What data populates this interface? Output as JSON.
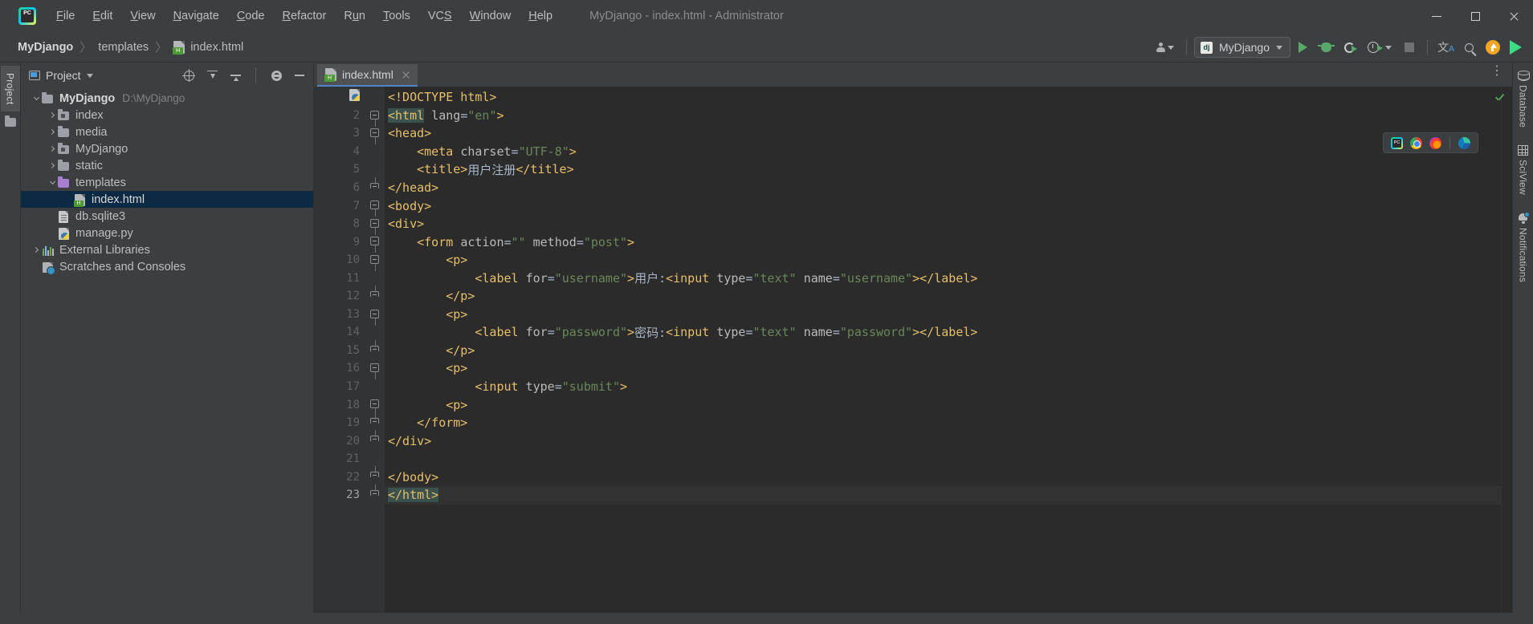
{
  "window": {
    "title": "MyDjango - index.html - Administrator",
    "app_icon": "pycharm-logo-icon",
    "minimize_label": "Minimize",
    "maximize_label": "Maximize",
    "close_label": "Close"
  },
  "menu": [
    {
      "label": "File",
      "mnemonic": "F"
    },
    {
      "label": "Edit",
      "mnemonic": "E"
    },
    {
      "label": "View",
      "mnemonic": "V"
    },
    {
      "label": "Navigate",
      "mnemonic": "N"
    },
    {
      "label": "Code",
      "mnemonic": "C"
    },
    {
      "label": "Refactor",
      "mnemonic": "R"
    },
    {
      "label": "Run",
      "mnemonic": "u"
    },
    {
      "label": "Tools",
      "mnemonic": "T"
    },
    {
      "label": "VCS",
      "mnemonic": "S"
    },
    {
      "label": "Window",
      "mnemonic": "W"
    },
    {
      "label": "Help",
      "mnemonic": "H"
    }
  ],
  "breadcrumb": {
    "items": [
      "MyDjango",
      "templates",
      "index.html"
    ],
    "separator": "〉",
    "file_icon": "html-file-icon"
  },
  "toolbar": {
    "user_icon": "user-account-icon",
    "run_config": {
      "icon": "django-icon",
      "icon_text": "dj",
      "name": "MyDjango"
    },
    "buttons": [
      {
        "name": "run-button",
        "icon": "play-icon"
      },
      {
        "name": "debug-button",
        "icon": "bug-icon"
      },
      {
        "name": "run-with-coverage-button",
        "icon": "coverage-icon"
      },
      {
        "name": "profile-button",
        "icon": "profiler-icon"
      },
      {
        "name": "stop-button",
        "icon": "stop-icon"
      },
      {
        "name": "translate-button",
        "icon": "translate-icon"
      },
      {
        "name": "search-everywhere-button",
        "icon": "search-icon"
      },
      {
        "name": "update-button",
        "icon": "update-arrow-icon"
      },
      {
        "name": "plugin-button",
        "icon": "colorful-play-icon"
      }
    ],
    "translate_glyph": "文",
    "translate_sub": "A"
  },
  "left_stripe": {
    "project_tab": "Project",
    "folder_icon": "folder-icon"
  },
  "project_panel": {
    "title": "Project",
    "title_icon": "project-view-icon",
    "actions": [
      {
        "name": "locate-file-button",
        "icon": "locate-icon"
      },
      {
        "name": "expand-all-button",
        "icon": "expand-all-icon"
      },
      {
        "name": "collapse-all-button",
        "icon": "collapse-all-icon"
      },
      {
        "name": "settings-button",
        "icon": "gear-icon"
      },
      {
        "name": "hide-button",
        "icon": "minimize-icon"
      }
    ],
    "tree": [
      {
        "label": "MyDjango",
        "path": "D:\\MyDjango",
        "icon": "folder-icon",
        "indent": 0,
        "arrow": "down",
        "bold": true,
        "selected": false
      },
      {
        "label": "index",
        "path": "",
        "icon": "module-folder-icon",
        "indent": 1,
        "arrow": "right",
        "bold": false,
        "selected": false
      },
      {
        "label": "media",
        "path": "",
        "icon": "folder-icon",
        "indent": 1,
        "arrow": "right",
        "bold": false,
        "selected": false
      },
      {
        "label": "MyDjango",
        "path": "",
        "icon": "module-folder-icon",
        "indent": 1,
        "arrow": "right",
        "bold": false,
        "selected": false
      },
      {
        "label": "static",
        "path": "",
        "icon": "folder-icon",
        "indent": 1,
        "arrow": "right",
        "bold": false,
        "selected": false
      },
      {
        "label": "templates",
        "path": "",
        "icon": "templates-folder-icon",
        "indent": 1,
        "arrow": "down",
        "bold": false,
        "selected": false
      },
      {
        "label": "index.html",
        "path": "",
        "icon": "html-file-icon",
        "indent": 2,
        "arrow": "none",
        "bold": false,
        "selected": true
      },
      {
        "label": "db.sqlite3",
        "path": "",
        "icon": "database-file-icon",
        "indent": 1,
        "arrow": "none",
        "bold": false,
        "selected": false
      },
      {
        "label": "manage.py",
        "path": "",
        "icon": "python-file-icon",
        "indent": 1,
        "arrow": "none",
        "bold": false,
        "selected": false
      },
      {
        "label": "External Libraries",
        "path": "",
        "icon": "libraries-icon",
        "indent": 0,
        "arrow": "right",
        "bold": false,
        "selected": false
      },
      {
        "label": "Scratches and Consoles",
        "path": "",
        "icon": "scratches-icon",
        "indent": 0,
        "arrow": "none",
        "bold": false,
        "selected": false
      }
    ]
  },
  "editor": {
    "tab": {
      "label": "index.html",
      "icon": "html-file-icon",
      "close_icon": "close-icon"
    },
    "options_icon": "more-options-icon",
    "gutter_icon": "python-run-icon",
    "inspection_status": "ok",
    "browser_preview": [
      {
        "name": "pycharm-preview-icon"
      },
      {
        "name": "chrome-icon"
      },
      {
        "name": "firefox-icon"
      },
      {
        "name": "edge-icon"
      }
    ],
    "lines": [
      {
        "n": 1,
        "fold": "none",
        "tokens": [
          {
            "t": "<!DOCTYPE html>",
            "c": "tg"
          }
        ]
      },
      {
        "n": 2,
        "fold": "top",
        "tokens": [
          {
            "t": "<html",
            "c": "tg hl"
          },
          {
            "t": " ",
            "c": "tx"
          },
          {
            "t": "lang",
            "c": "at"
          },
          {
            "t": "=",
            "c": "tx"
          },
          {
            "t": "\"en\"",
            "c": "st"
          },
          {
            "t": ">",
            "c": "tg"
          }
        ]
      },
      {
        "n": 3,
        "fold": "top",
        "tokens": [
          {
            "t": "<head>",
            "c": "tg"
          }
        ]
      },
      {
        "n": 4,
        "fold": "none",
        "tokens": [
          {
            "t": "    <meta ",
            "c": "tg"
          },
          {
            "t": "charset",
            "c": "at"
          },
          {
            "t": "=",
            "c": "tx"
          },
          {
            "t": "\"UTF-8\"",
            "c": "st"
          },
          {
            "t": ">",
            "c": "tg"
          }
        ]
      },
      {
        "n": 5,
        "fold": "none",
        "tokens": [
          {
            "t": "    <title>",
            "c": "tg"
          },
          {
            "t": "用户注册",
            "c": "tx"
          },
          {
            "t": "</title>",
            "c": "tg"
          }
        ]
      },
      {
        "n": 6,
        "fold": "bot",
        "tokens": [
          {
            "t": "</head>",
            "c": "tg"
          }
        ]
      },
      {
        "n": 7,
        "fold": "top",
        "tokens": [
          {
            "t": "<body>",
            "c": "tg"
          }
        ]
      },
      {
        "n": 8,
        "fold": "top",
        "tokens": [
          {
            "t": "<div>",
            "c": "tg"
          }
        ]
      },
      {
        "n": 9,
        "fold": "top",
        "tokens": [
          {
            "t": "    <form ",
            "c": "tg"
          },
          {
            "t": "action",
            "c": "at"
          },
          {
            "t": "=",
            "c": "tx"
          },
          {
            "t": "\"\"",
            "c": "st"
          },
          {
            "t": " ",
            "c": "tx"
          },
          {
            "t": "method",
            "c": "at"
          },
          {
            "t": "=",
            "c": "tx"
          },
          {
            "t": "\"post\"",
            "c": "st"
          },
          {
            "t": ">",
            "c": "tg"
          }
        ]
      },
      {
        "n": 10,
        "fold": "top",
        "tokens": [
          {
            "t": "        <p>",
            "c": "tg"
          }
        ]
      },
      {
        "n": 11,
        "fold": "none",
        "tokens": [
          {
            "t": "            <label ",
            "c": "tg"
          },
          {
            "t": "for",
            "c": "at"
          },
          {
            "t": "=",
            "c": "tx"
          },
          {
            "t": "\"username\"",
            "c": "st"
          },
          {
            "t": ">",
            "c": "tg"
          },
          {
            "t": "用户:",
            "c": "tx"
          },
          {
            "t": "<input ",
            "c": "tg"
          },
          {
            "t": "type",
            "c": "at"
          },
          {
            "t": "=",
            "c": "tx"
          },
          {
            "t": "\"text\"",
            "c": "st"
          },
          {
            "t": " ",
            "c": "tx"
          },
          {
            "t": "name",
            "c": "at"
          },
          {
            "t": "=",
            "c": "tx"
          },
          {
            "t": "\"username\"",
            "c": "st"
          },
          {
            "t": "></label>",
            "c": "tg"
          }
        ]
      },
      {
        "n": 12,
        "fold": "bot",
        "tokens": [
          {
            "t": "        </p>",
            "c": "tg"
          }
        ]
      },
      {
        "n": 13,
        "fold": "top",
        "tokens": [
          {
            "t": "        <p>",
            "c": "tg"
          }
        ]
      },
      {
        "n": 14,
        "fold": "none",
        "tokens": [
          {
            "t": "            <label ",
            "c": "tg"
          },
          {
            "t": "for",
            "c": "at"
          },
          {
            "t": "=",
            "c": "tx"
          },
          {
            "t": "\"password\"",
            "c": "st"
          },
          {
            "t": ">",
            "c": "tg"
          },
          {
            "t": "密码:",
            "c": "tx"
          },
          {
            "t": "<input ",
            "c": "tg"
          },
          {
            "t": "type",
            "c": "at"
          },
          {
            "t": "=",
            "c": "tx"
          },
          {
            "t": "\"text\"",
            "c": "st"
          },
          {
            "t": " ",
            "c": "tx"
          },
          {
            "t": "name",
            "c": "at"
          },
          {
            "t": "=",
            "c": "tx"
          },
          {
            "t": "\"password\"",
            "c": "st"
          },
          {
            "t": "></label>",
            "c": "tg"
          }
        ]
      },
      {
        "n": 15,
        "fold": "bot",
        "tokens": [
          {
            "t": "        </p>",
            "c": "tg"
          }
        ]
      },
      {
        "n": 16,
        "fold": "top",
        "tokens": [
          {
            "t": "        <p>",
            "c": "tg"
          }
        ]
      },
      {
        "n": 17,
        "fold": "none",
        "tokens": [
          {
            "t": "            <input ",
            "c": "tg"
          },
          {
            "t": "type",
            "c": "at"
          },
          {
            "t": "=",
            "c": "tx"
          },
          {
            "t": "\"submit\"",
            "c": "st"
          },
          {
            "t": ">",
            "c": "tg"
          }
        ]
      },
      {
        "n": 18,
        "fold": "top",
        "tokens": [
          {
            "t": "        <p>",
            "c": "tg"
          }
        ]
      },
      {
        "n": 19,
        "fold": "bot",
        "tokens": [
          {
            "t": "    </form>",
            "c": "tg"
          }
        ]
      },
      {
        "n": 20,
        "fold": "bot",
        "tokens": [
          {
            "t": "</div>",
            "c": "tg"
          }
        ]
      },
      {
        "n": 21,
        "fold": "none",
        "tokens": []
      },
      {
        "n": 22,
        "fold": "bot",
        "tokens": [
          {
            "t": "</body>",
            "c": "tg"
          }
        ]
      },
      {
        "n": 23,
        "fold": "bot",
        "current": true,
        "tokens": [
          {
            "t": "</html>",
            "c": "tg hl"
          }
        ]
      }
    ]
  },
  "right_stripe": [
    {
      "label": "Database",
      "icon": "database-icon",
      "badge": false
    },
    {
      "label": "SciView",
      "icon": "grid-icon",
      "badge": false
    },
    {
      "label": "Notifications",
      "icon": "bell-icon",
      "badge": true
    }
  ],
  "colors": {
    "accent": "#4a88c7",
    "selection": "#0d2a44",
    "tag": "#e8bf6a",
    "string": "#6a8759",
    "text": "#a9b7c6",
    "editor_bg": "#2b2b2b",
    "chrome_bg": "#3c3f41"
  }
}
